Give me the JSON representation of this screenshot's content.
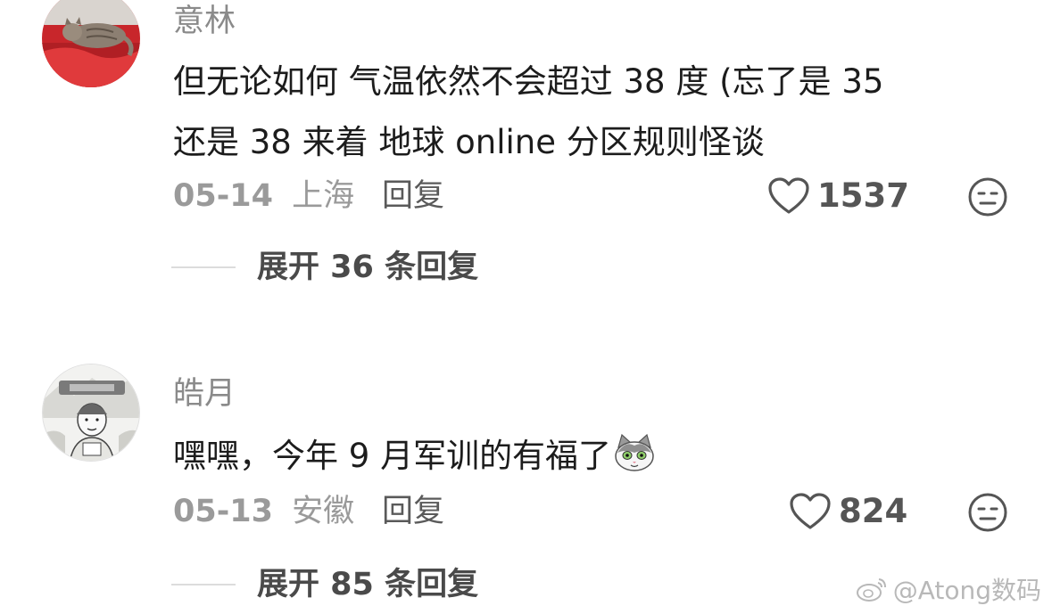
{
  "comments": [
    {
      "username": "意林",
      "text_line1": "但无论如何 气温依然不会超过 38 度 (忘了是 35",
      "text_line2": "还是 38 来着 地球 online 分区规则怪谈",
      "date": "05-14",
      "location": "上海",
      "reply_label": "回复",
      "likes": "1537",
      "expand_label": "展开 36 条回复",
      "avatar_icon": "cat-on-red-cloth-avatar"
    },
    {
      "username": "皓月",
      "text_line1": "嘿嘿，今年 9 月军训的有福了",
      "date": "05-13",
      "location": "安徽",
      "reply_label": "回复",
      "likes": "824",
      "expand_label": "展开 85 条回复",
      "avatar_icon": "sketch-person-avatar",
      "emoji": "cat-face-emoji"
    }
  ],
  "watermark": "@Atong数码",
  "colors": {
    "username": "#8a8a8a",
    "meta": "#9a9a9a",
    "text": "#1c1c1c",
    "divider": "#dcdcdc"
  }
}
